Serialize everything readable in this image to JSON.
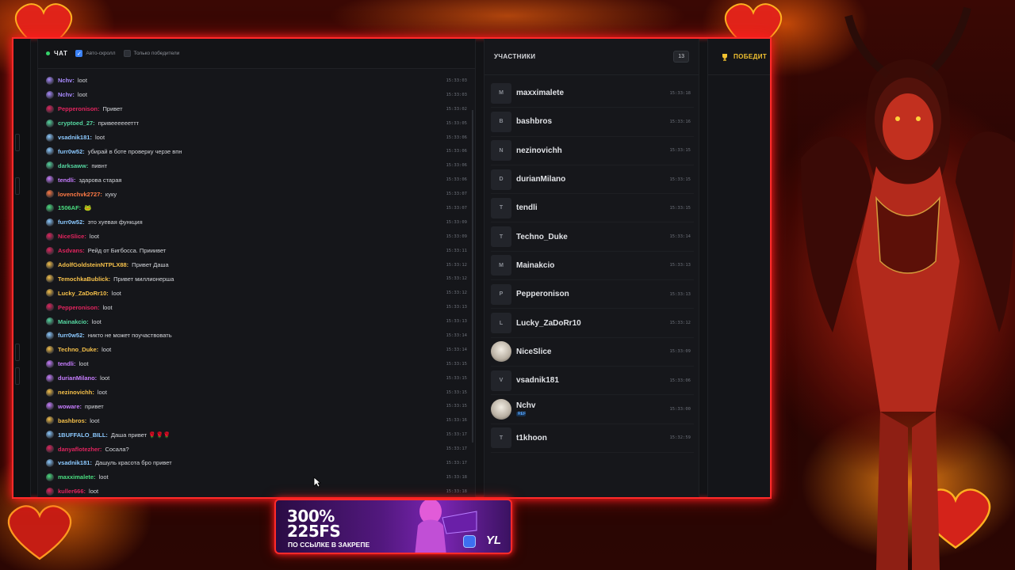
{
  "chat": {
    "title": "ЧАТ",
    "autoscroll_label": "Авто-скролл",
    "winners_only_label": "Только победители",
    "messages": [
      {
        "user": "Nchv:",
        "text": "loot",
        "time": "15:33:03",
        "color": "#a98bff"
      },
      {
        "user": "Nchv:",
        "text": "loot",
        "time": "15:33:03",
        "color": "#a98bff"
      },
      {
        "user": "Pepperonison:",
        "text": "Привет",
        "time": "15:33:02",
        "color": "#e0245e"
      },
      {
        "user": "cryptoed_27:",
        "text": "привееееееттт",
        "time": "15:33:05",
        "color": "#55d6a0"
      },
      {
        "user": "vsadnik181:",
        "text": "loot",
        "time": "15:33:06",
        "color": "#8cc9ff"
      },
      {
        "user": "furr0w52:",
        "text": "убирай в боте проверку черзе впн",
        "time": "15:33:06",
        "color": "#8cc9ff"
      },
      {
        "user": "darksaww:",
        "text": "пивнт",
        "time": "15:33:06",
        "color": "#55d6a0"
      },
      {
        "user": "tendli:",
        "text": "здарова старая",
        "time": "15:33:06",
        "color": "#c77dff"
      },
      {
        "user": "lovenchvk2727:",
        "text": "куку",
        "time": "15:33:07",
        "color": "#ff7a45"
      },
      {
        "user": "1506AF:",
        "text": "🐸",
        "time": "15:33:07",
        "color": "#4ade80"
      },
      {
        "user": "furr0w52:",
        "text": "это хуевая функция",
        "time": "15:33:09",
        "color": "#8cc9ff"
      },
      {
        "user": "NiceSlice:",
        "text": "loot",
        "time": "15:33:09",
        "color": "#e0245e"
      },
      {
        "user": "Asdvans:",
        "text": "Рейд от Бигбосса. Прииивет",
        "time": "15:33:11",
        "color": "#e0245e"
      },
      {
        "user": "AdolfGoldsteinNTPLX88:",
        "text": "Привет Даша",
        "time": "15:33:12",
        "color": "#f5c04a"
      },
      {
        "user": "TemochkaBublick:",
        "text": "Привет миллионерша",
        "time": "15:33:12",
        "color": "#f5c04a"
      },
      {
        "user": "Lucky_ZaDoRr10:",
        "text": "loot",
        "time": "15:33:12",
        "color": "#f5c04a"
      },
      {
        "user": "Pepperonison:",
        "text": "loot",
        "time": "15:33:13",
        "color": "#e0245e"
      },
      {
        "user": "Mainakcio:",
        "text": "loot",
        "time": "15:33:13",
        "color": "#55d6a0"
      },
      {
        "user": "furr0w52:",
        "text": "никто не может поучаствовать",
        "time": "15:33:14",
        "color": "#8cc9ff"
      },
      {
        "user": "Techno_Duke:",
        "text": "loot",
        "time": "15:33:14",
        "color": "#f5c04a"
      },
      {
        "user": "tendli:",
        "text": "loot",
        "time": "15:33:15",
        "color": "#c77dff"
      },
      {
        "user": "durianMilano:",
        "text": "loot",
        "time": "15:33:15",
        "color": "#c77dff"
      },
      {
        "user": "nezinovichh:",
        "text": "loot",
        "time": "15:33:15",
        "color": "#f5c04a"
      },
      {
        "user": "woware:",
        "text": "привет",
        "time": "15:33:15",
        "color": "#c77dff"
      },
      {
        "user": "bashbros:",
        "text": "loot",
        "time": "15:33:16",
        "color": "#f5c04a"
      },
      {
        "user": "1BUFFALO_BILL:",
        "text": "Даша привет 🌹🌹🌹",
        "time": "15:33:17",
        "color": "#8cc9ff"
      },
      {
        "user": "danyaflotezher:",
        "text": "Сосала?",
        "time": "15:33:17",
        "color": "#e0245e"
      },
      {
        "user": "vsadnik181:",
        "text": "Дашуль красота бро привет",
        "time": "15:33:17",
        "color": "#8cc9ff"
      },
      {
        "user": "maxximalete:",
        "text": "loot",
        "time": "15:33:18",
        "color": "#4ade80"
      },
      {
        "user": "kuller666:",
        "text": "loot",
        "time": "15:33:18",
        "color": "#e0245e"
      }
    ]
  },
  "participants": {
    "title": "УЧАСТНИКИ",
    "count": "13",
    "items": [
      {
        "initial": "M",
        "name": "maxximalete",
        "time": "15:33:18"
      },
      {
        "initial": "B",
        "name": "bashbros",
        "time": "15:33:16"
      },
      {
        "initial": "N",
        "name": "nezinovichh",
        "time": "15:33:15"
      },
      {
        "initial": "D",
        "name": "durianMilano",
        "time": "15:33:15"
      },
      {
        "initial": "T",
        "name": "tendli",
        "time": "15:33:15"
      },
      {
        "initial": "T",
        "name": "Techno_Duke",
        "time": "15:33:14"
      },
      {
        "initial": "M",
        "name": "Mainakcio",
        "time": "15:33:13"
      },
      {
        "initial": "P",
        "name": "Pepperonison",
        "time": "15:33:13"
      },
      {
        "initial": "L",
        "name": "Lucky_ZaDoRr10",
        "time": "15:33:12"
      },
      {
        "initial": "",
        "name": "NiceSlice",
        "time": "15:33:09",
        "photo": true
      },
      {
        "initial": "V",
        "name": "vsadnik181",
        "time": "15:33:06"
      },
      {
        "initial": "",
        "name": "Nchv",
        "time": "15:33:00",
        "photo": true,
        "tag": "REF"
      },
      {
        "initial": "T",
        "name": "t1khoon",
        "time": "15:32:59"
      }
    ]
  },
  "winners": {
    "title": "ПОБЕДИТ"
  },
  "promo": {
    "line1": "300%",
    "line2": "225FS",
    "subtitle": "ПО ССЫЛКЕ В ЗАКРЕПЕ",
    "logo": "YL"
  },
  "colors": {
    "frame_border": "#ff2a2a",
    "checkbox_on": "#3b82f6",
    "winners_title": "#f2c230"
  }
}
